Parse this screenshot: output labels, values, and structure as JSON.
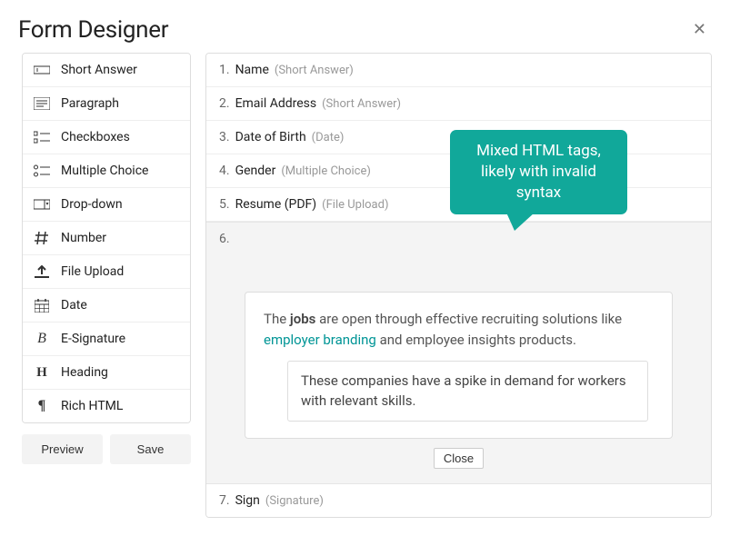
{
  "header": {
    "title": "Form Designer"
  },
  "sidebar": {
    "items": [
      {
        "label": "Short Answer",
        "icon": "short-answer-icon"
      },
      {
        "label": "Paragraph",
        "icon": "paragraph-icon"
      },
      {
        "label": "Checkboxes",
        "icon": "checkboxes-icon"
      },
      {
        "label": "Multiple Choice",
        "icon": "multiple-choice-icon"
      },
      {
        "label": "Drop-down",
        "icon": "dropdown-icon"
      },
      {
        "label": "Number",
        "icon": "number-icon"
      },
      {
        "label": "File Upload",
        "icon": "file-upload-icon"
      },
      {
        "label": "Date",
        "icon": "date-icon"
      },
      {
        "label": "E-Signature",
        "icon": "signature-icon"
      },
      {
        "label": "Heading",
        "icon": "heading-icon"
      },
      {
        "label": "Rich HTML",
        "icon": "rich-html-icon"
      }
    ],
    "preview_label": "Preview",
    "save_label": "Save"
  },
  "fields": [
    {
      "num": "1.",
      "name": "Name",
      "type": "(Short Answer)"
    },
    {
      "num": "2.",
      "name": "Email Address",
      "type": "(Short Answer)"
    },
    {
      "num": "3.",
      "name": "Date of Birth",
      "type": "(Date)"
    },
    {
      "num": "4.",
      "name": "Gender",
      "type": "(Multiple Choice)"
    },
    {
      "num": "5.",
      "name": "Resume (PDF)",
      "type": "(File Upload)"
    }
  ],
  "active_field_num": "6.",
  "editor": {
    "t1": "The ",
    "bold": "jobs",
    "t2": " are open through effective recruiting solutions like ",
    "link": "employer branding",
    "t3": " and employee insights products.",
    "inner": "These companies have a spike in demand for workers with relevant skills."
  },
  "close_label": "Close",
  "last_field": {
    "num": "7.",
    "name": "Sign",
    "type": "(Signature)"
  },
  "tooltip_text": "Mixed HTML tags, likely with invalid syntax"
}
